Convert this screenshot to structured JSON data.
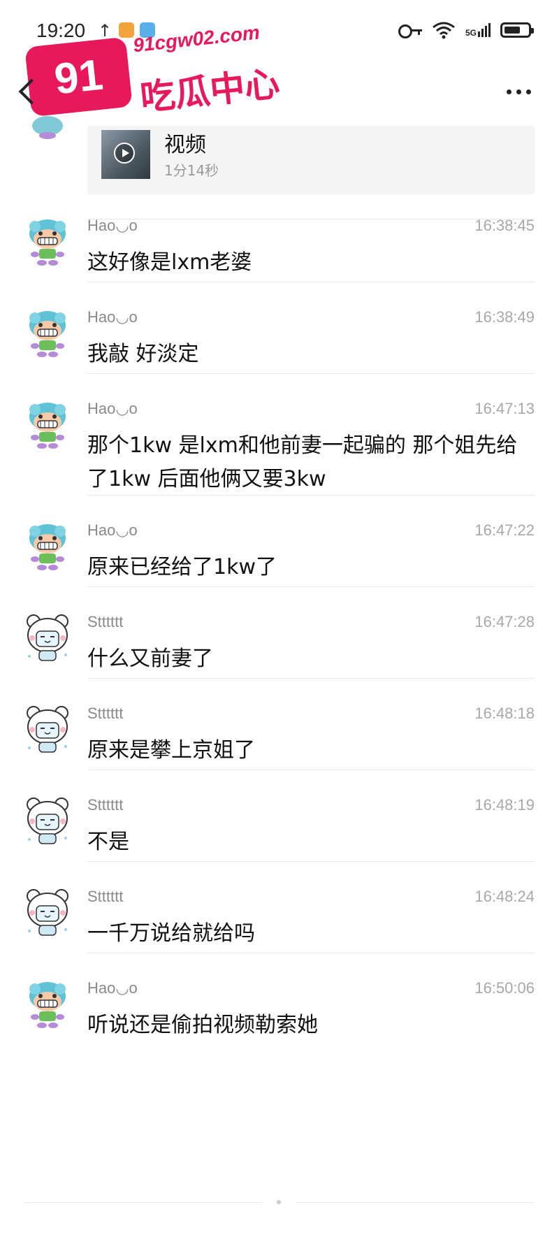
{
  "status_bar": {
    "time": "19:20",
    "upload_icon": "arrow-up-icon",
    "network_label": "5G",
    "battery_level": 0.7
  },
  "watermark": {
    "badge": "91",
    "url": "91cgw02.com",
    "title": "吃瓜中心",
    "color": "#e8195a"
  },
  "video_message": {
    "title": "视频",
    "duration": "1分14秒"
  },
  "messages": [
    {
      "sender": "Hao◡o",
      "time": "16:38:45",
      "text": "这好像是lxm老婆",
      "avatar": "jellyfish"
    },
    {
      "sender": "Hao◡o",
      "time": "16:38:49",
      "text": "我敲 好淡定",
      "avatar": "jellyfish"
    },
    {
      "sender": "Hao◡o",
      "time": "16:47:13",
      "text": "那个1kw 是lxm和他前妻一起骗的 那个姐先给了1kw 后面他俩又要3kw",
      "avatar": "jellyfish"
    },
    {
      "sender": "Hao◡o",
      "time": "16:47:22",
      "text": "原来已经给了1kw了",
      "avatar": "jellyfish"
    },
    {
      "sender": "Stttttt",
      "time": "16:47:28",
      "text": "什么又前妻了",
      "avatar": "bear"
    },
    {
      "sender": "Stttttt",
      "time": "16:48:18",
      "text": "原来是攀上京姐了",
      "avatar": "bear"
    },
    {
      "sender": "Stttttt",
      "time": "16:48:19",
      "text": "不是",
      "avatar": "bear"
    },
    {
      "sender": "Stttttt",
      "time": "16:48:24",
      "text": "一千万说给就给吗",
      "avatar": "bear"
    },
    {
      "sender": "Hao◡o",
      "time": "16:50:06",
      "text": "听说还是偷拍视频勒索她",
      "avatar": "jellyfish"
    }
  ]
}
